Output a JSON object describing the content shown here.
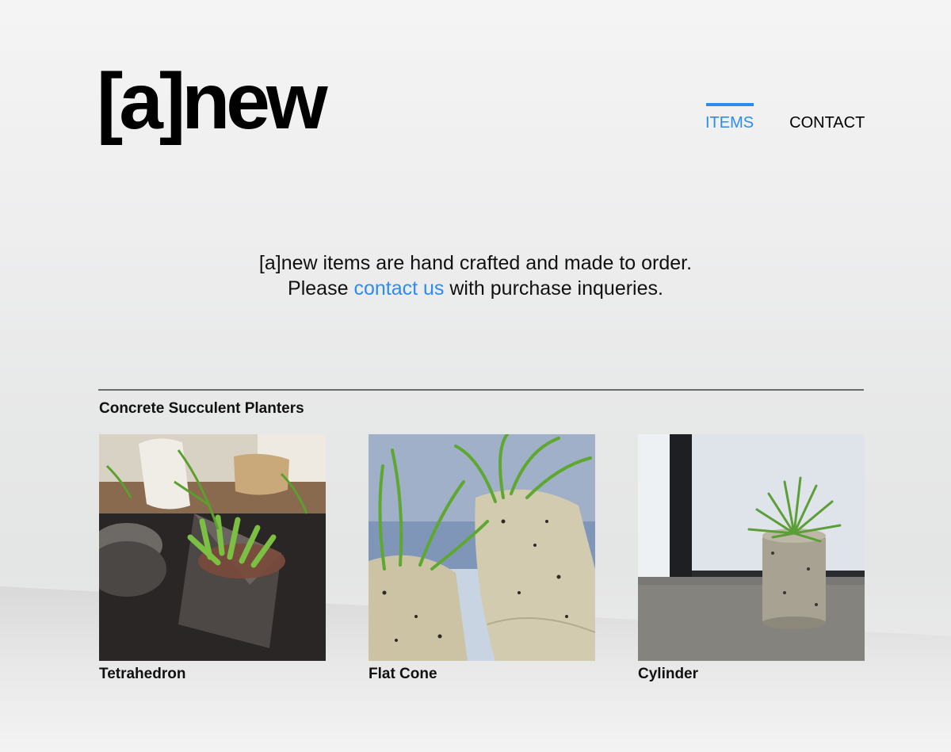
{
  "header": {
    "logo_text": "[a]new",
    "nav": [
      {
        "label": "ITEMS",
        "active": true
      },
      {
        "label": "CONTACT",
        "active": false
      }
    ]
  },
  "intro": {
    "line1": "[a]new items are hand crafted and made to order.",
    "line2_before": "Please",
    "line2_link": "contact us",
    "line2_after": "with purchase inqueries."
  },
  "section": {
    "title": "Concrete Succulent Planters",
    "items": [
      {
        "name": "Tetrahedron",
        "image_icon": "tetrahedron-planter-photo"
      },
      {
        "name": "Flat Cone",
        "image_icon": "flat-cone-planter-photo"
      },
      {
        "name": "Cylinder",
        "image_icon": "cylinder-planter-photo"
      }
    ]
  },
  "colors": {
    "accent": "#2c8cf0",
    "text": "#111111",
    "divider": "#6b6b6b"
  }
}
